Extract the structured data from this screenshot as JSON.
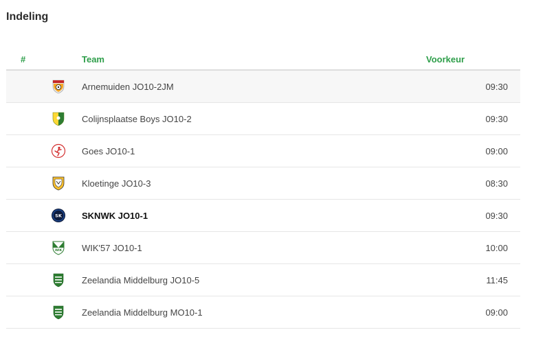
{
  "page": {
    "title": "Indeling"
  },
  "table": {
    "headers": {
      "number": "#",
      "team": "Team",
      "preference": "Voorkeur"
    },
    "rows": [
      {
        "team": "Arnemuiden JO10-2JM",
        "time": "09:30",
        "logo": "arnemuiden-logo-icon",
        "highlight": false
      },
      {
        "team": "Colijnsplaatse Boys JO10-2",
        "time": "09:30",
        "logo": "colijnsplaatse-boys-logo-icon",
        "highlight": false
      },
      {
        "team": "Goes JO10-1",
        "time": "09:00",
        "logo": "goes-logo-icon",
        "highlight": false
      },
      {
        "team": "Kloetinge JO10-3",
        "time": "08:30",
        "logo": "kloetinge-logo-icon",
        "highlight": false
      },
      {
        "team": "SKNWK JO10-1",
        "time": "09:30",
        "logo": "sknwk-logo-icon",
        "highlight": true
      },
      {
        "team": "WIK'57 JO10-1",
        "time": "10:00",
        "logo": "wik57-logo-icon",
        "highlight": false
      },
      {
        "team": "Zeelandia Middelburg JO10-5",
        "time": "11:45",
        "logo": "zeelandia-logo-icon",
        "highlight": false
      },
      {
        "team": "Zeelandia Middelburg MO10-1",
        "time": "09:00",
        "logo": "zeelandia-logo-icon",
        "highlight": false
      }
    ]
  },
  "colors": {
    "accent": "#2e9e4a",
    "row_alt": "#f7f7f7"
  }
}
